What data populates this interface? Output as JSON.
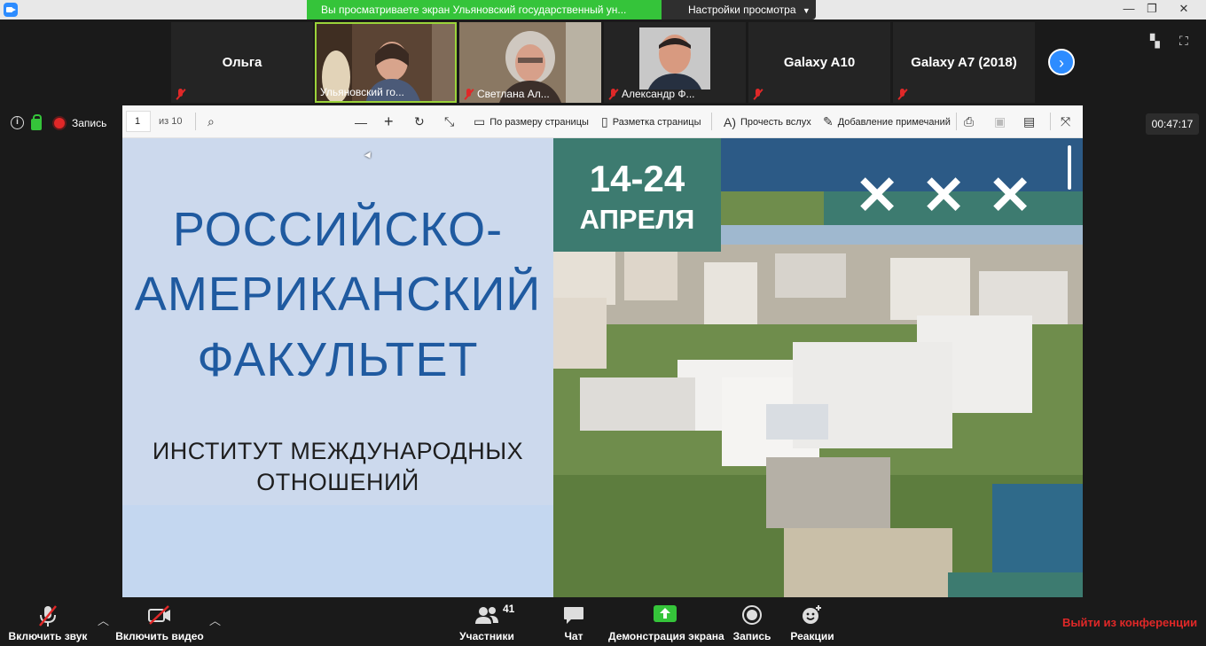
{
  "window": {
    "share_banner": "Вы просматриваете экран Ульяновский государственный ун...",
    "view_options": "Настройки просмотра"
  },
  "participants": [
    {
      "name": "Ольга",
      "caption": "",
      "has_video": false
    },
    {
      "name": "",
      "caption": "Ульяновский го...",
      "has_video": true
    },
    {
      "name": "",
      "caption": "Светлана Ал...",
      "has_video": true
    },
    {
      "name": "",
      "caption": "Александр Ф...",
      "has_video": true
    },
    {
      "name": "Galaxy A10",
      "caption": "",
      "has_video": false
    },
    {
      "name": "Galaxy A7 (2018)",
      "caption": "",
      "has_video": false
    }
  ],
  "indicators": {
    "recording_label": "Запись",
    "timer": "00:47:17"
  },
  "pdf_toolbar": {
    "page": "1",
    "page_of": "из 10",
    "fit_page": "По размеру страницы",
    "page_layout": "Разметка страницы",
    "read_aloud": "Прочесть вслух",
    "add_notes": "Добавление примечаний"
  },
  "slide": {
    "title_lines": [
      "РОССИЙСКО-",
      "АМЕРИКАНСКИЙ",
      "ФАКУЛЬТЕТ"
    ],
    "subtitle_lines": [
      "ИНСТИТУТ МЕЖДУНАРОДНЫХ",
      "ОТНОШЕНИЙ"
    ],
    "date_range": "14-24",
    "date_month": "АПРЕЛЯ"
  },
  "bottom_bar": {
    "unmute": "Включить звук",
    "start_video": "Включить видео",
    "participants": "Участники",
    "participants_count": "41",
    "chat": "Чат",
    "share_screen": "Демонстрация экрана",
    "record": "Запись",
    "reactions": "Реакции",
    "leave": "Выйти из конференции"
  },
  "colors": {
    "zoom_blue": "#2d8cff",
    "share_green": "#35c43a",
    "leave_red": "#e02828",
    "slide_title_blue": "#1f5aa0",
    "slide_teal": "#3d7b70"
  }
}
